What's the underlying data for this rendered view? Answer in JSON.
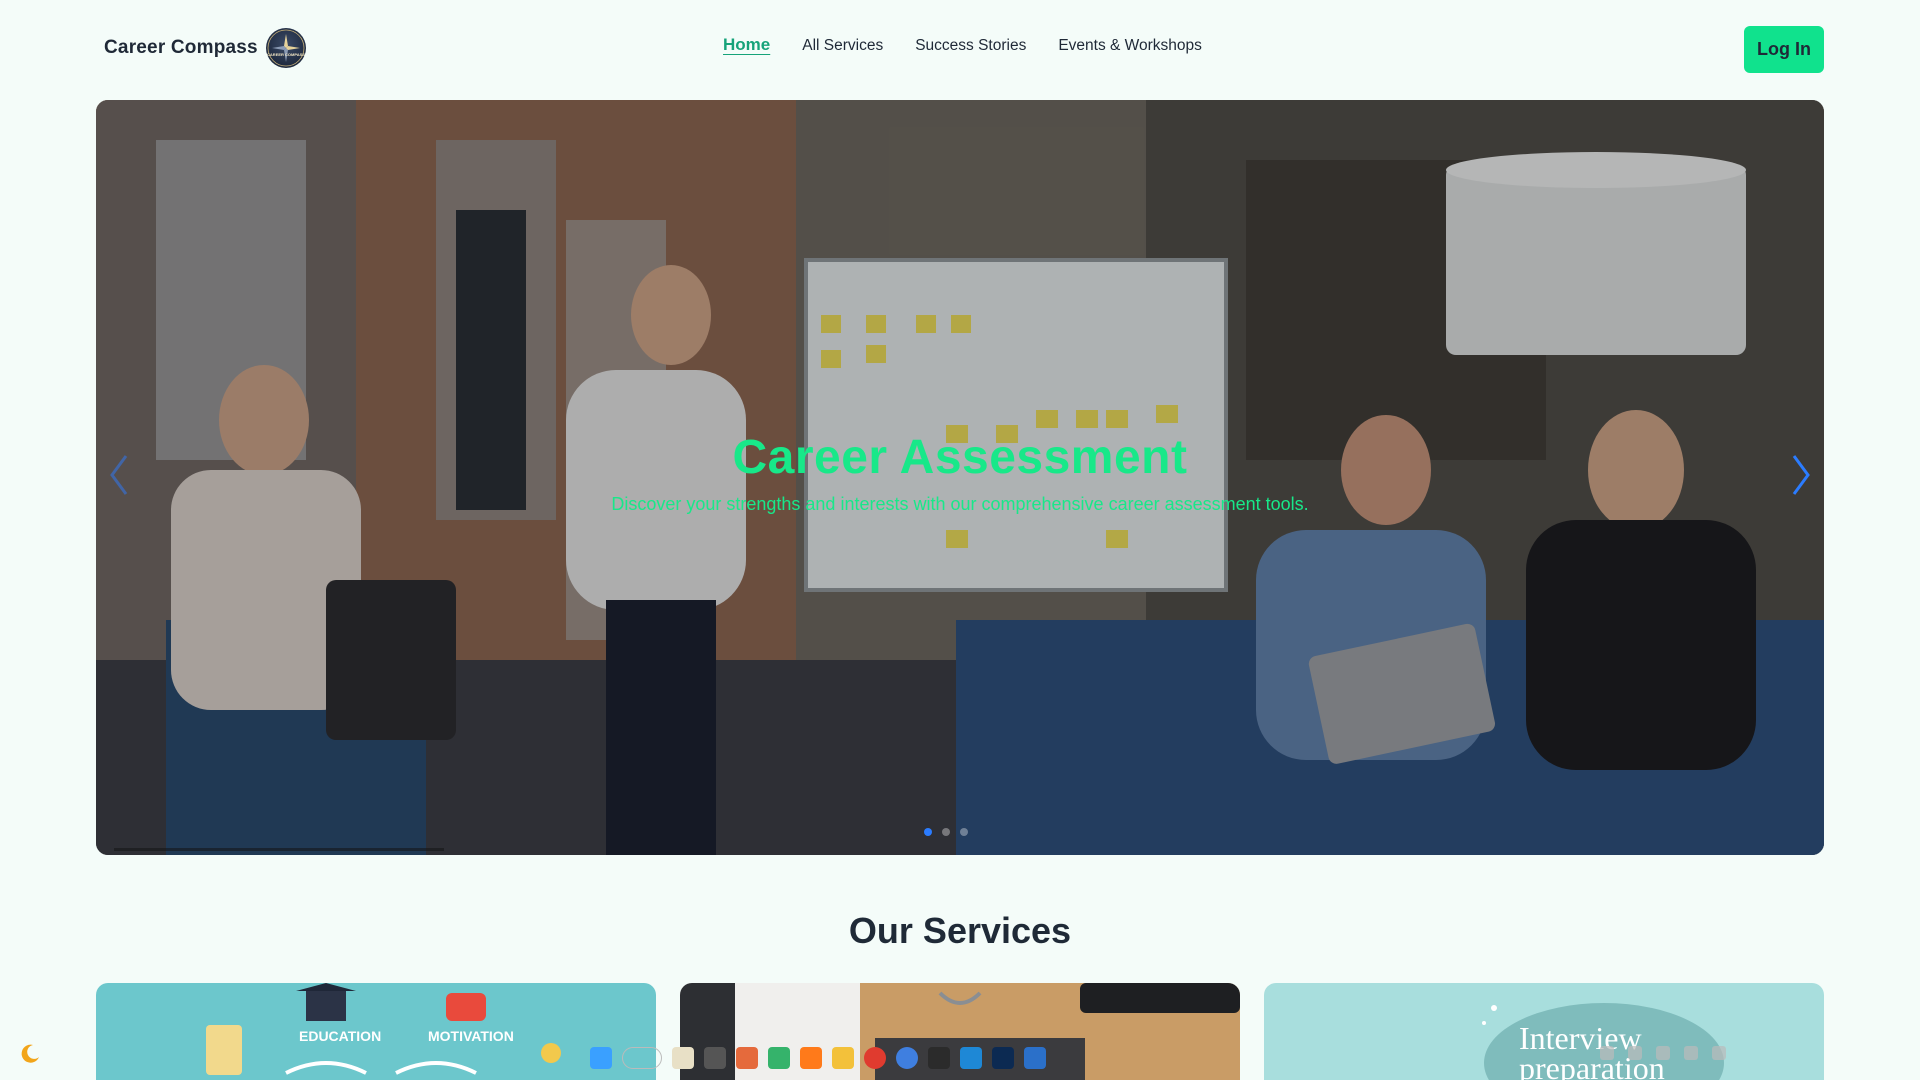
{
  "brand": {
    "name": "Career Compass",
    "logo_text": "CAREER COMPASS"
  },
  "nav": {
    "items": [
      {
        "label": "Home",
        "active": true
      },
      {
        "label": "All Services",
        "active": false
      },
      {
        "label": "Success Stories",
        "active": false
      },
      {
        "label": "Events & Workshops",
        "active": false
      }
    ],
    "login_label": "Log In"
  },
  "hero": {
    "title": "Career Assessment",
    "subtitle": "Discover your strengths and interests with our comprehensive career assessment tools.",
    "slide_count": 3,
    "active_slide": 1
  },
  "services": {
    "title": "Our Services",
    "cards": [
      {
        "labels": [
          "EDUCATION",
          "MOTIVATION"
        ]
      },
      {
        "labels": []
      },
      {
        "labels": [
          "Interview",
          "preparation"
        ]
      }
    ]
  },
  "colors": {
    "accent": "#10e28d",
    "accent_text": "#16a37a",
    "hero_text": "#18e889",
    "background": "#f4fcf9",
    "slider_dot_active": "#2b7cff"
  },
  "icons": [
    "moon-icon",
    "chevron-left-icon",
    "chevron-right-icon",
    "search-icon"
  ]
}
